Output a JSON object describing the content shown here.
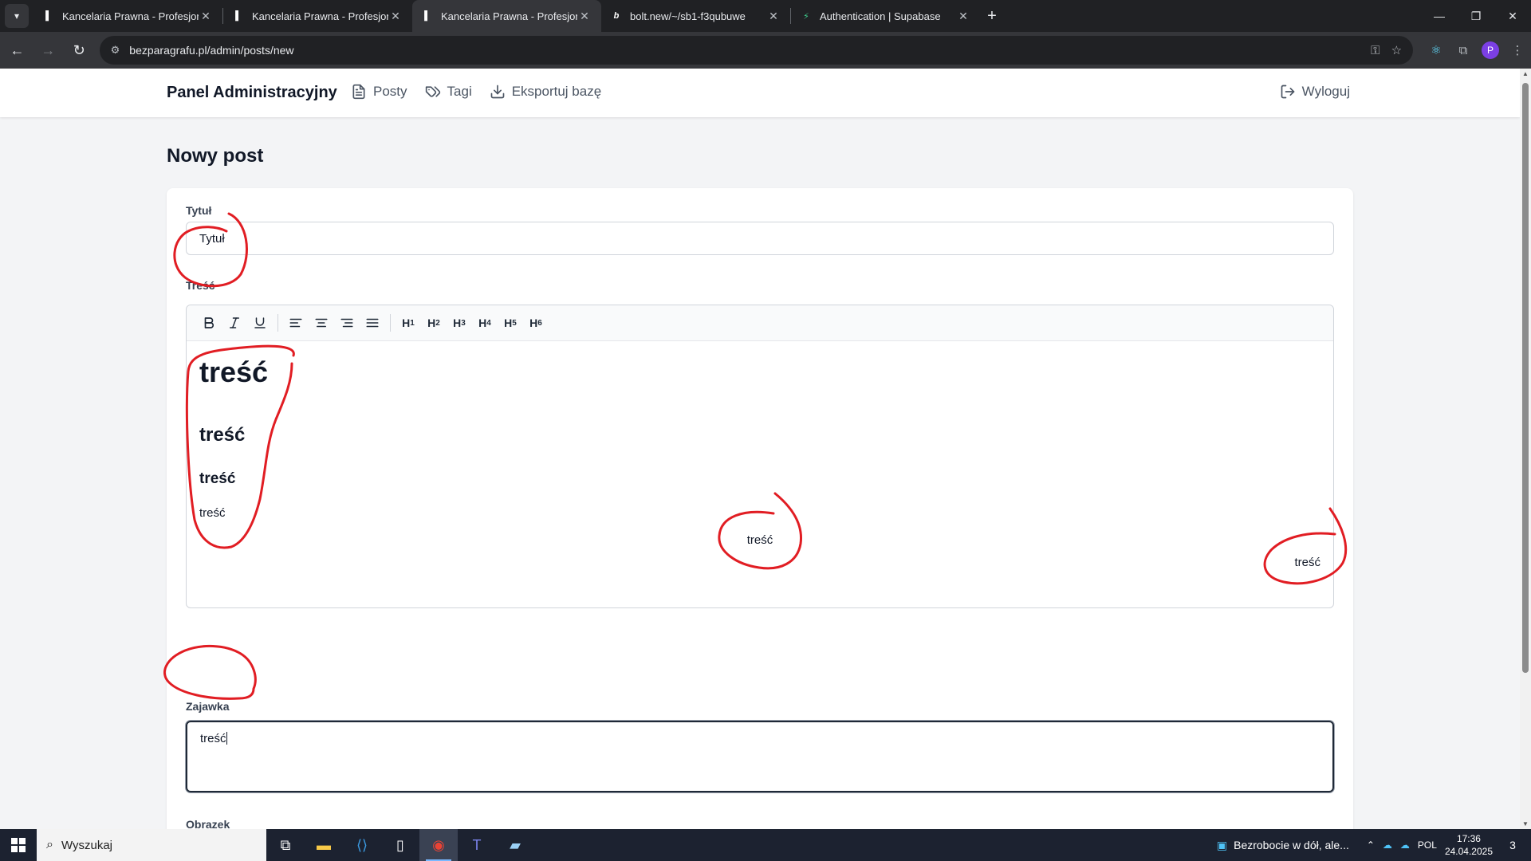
{
  "browser": {
    "tabs": [
      {
        "title": "Kancelaria Prawna - Profesjonal",
        "active": false
      },
      {
        "title": "Kancelaria Prawna - Profesjonal",
        "active": false
      },
      {
        "title": "Kancelaria Prawna - Profesjonal",
        "active": true
      },
      {
        "title": "bolt.new/~/sb1-f3qubuwe",
        "active": false
      },
      {
        "title": "Authentication | Supabase",
        "active": false
      }
    ],
    "url": "bezparagrafu.pl/admin/posts/new"
  },
  "admin_nav": {
    "brand": "Panel Administracyjny",
    "links": [
      {
        "label": "Posty",
        "icon": "document-icon"
      },
      {
        "label": "Tagi",
        "icon": "tag-icon"
      },
      {
        "label": "Eksportuj bazę",
        "icon": "download-icon"
      }
    ],
    "logout": "Wyloguj"
  },
  "page": {
    "title": "Nowy post"
  },
  "form": {
    "title_label": "Tytuł",
    "title_value": "Tytuł",
    "content_label": "Treść",
    "editor_toolbar": [
      "bold",
      "italic",
      "underline",
      "align-left",
      "align-center",
      "align-right",
      "align-justify",
      "H1",
      "H2",
      "H3",
      "H4",
      "H5",
      "H6"
    ],
    "content": {
      "h1": "treść",
      "h2": "treść",
      "h3": "treść",
      "p_left": "treść",
      "p_center": "treść",
      "p_right": "treść"
    },
    "excerpt_label": "Zajawka",
    "excerpt_value": "treść",
    "image_label": "Obrazek"
  },
  "taskbar": {
    "search_placeholder": "Wyszukaj",
    "weather": "Bezrobocie w dół, ale...",
    "lang": "POL",
    "time": "17:36",
    "date": "24.04.2025",
    "notifications": "3"
  },
  "colors": {
    "annotation": "#e11d23",
    "accent": "#1f2937"
  }
}
